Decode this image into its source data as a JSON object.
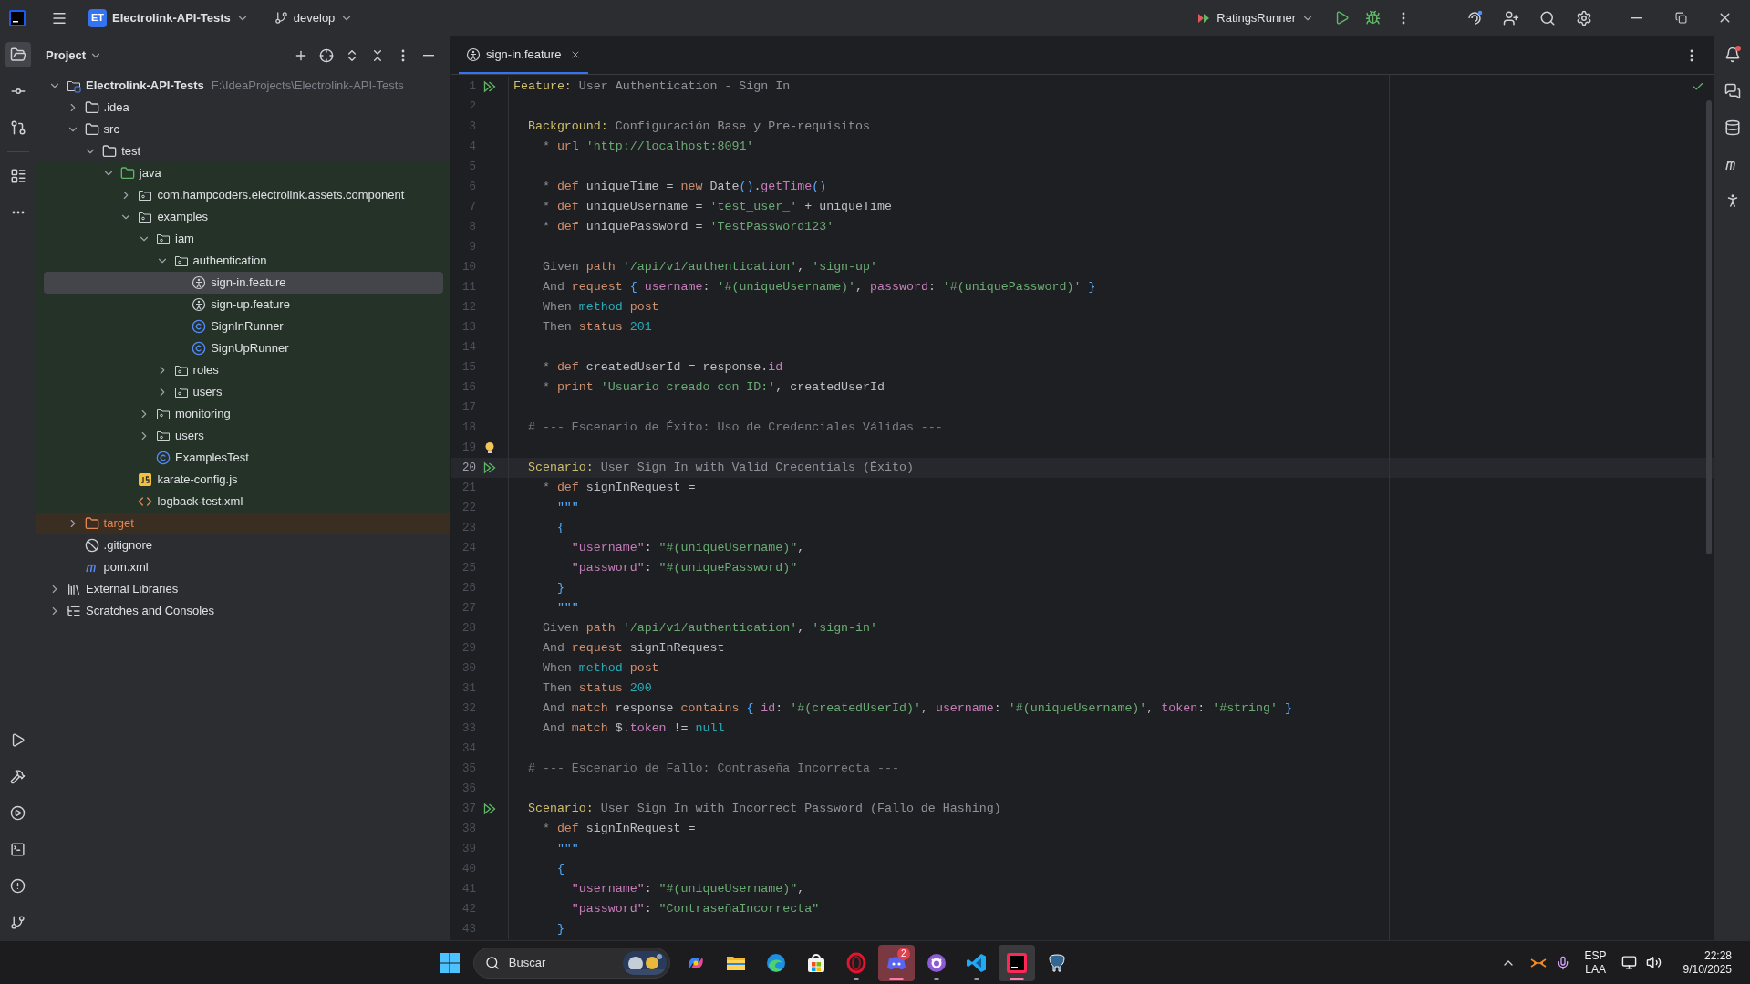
{
  "titlebar": {
    "project_badge": "ET",
    "project": "Electrolink-API-Tests",
    "branch": "develop",
    "run_config": "RatingsRunner"
  },
  "project_panel": {
    "title": "Project",
    "tree": [
      {
        "label": "Electrolink-API-Tests",
        "hint": "F:\\IdeaProjects\\Electrolink-API-Tests",
        "kind": "module",
        "expanded": true,
        "selected": false,
        "children": [
          {
            "label": ".idea",
            "kind": "folder",
            "expanded": false,
            "selected": false
          },
          {
            "label": "src",
            "kind": "folder",
            "expanded": true,
            "selected": false,
            "children": [
              {
                "label": "test",
                "kind": "folder",
                "expanded": true,
                "selected": false,
                "children": [
                  {
                    "label": "java",
                    "kind": "folder",
                    "expanded": true,
                    "selected": false,
                    "test_sources": true,
                    "children": [
                      {
                        "label": "com.hampcoders.electrolink.assets.component",
                        "kind": "package",
                        "expanded": false,
                        "selected": false
                      },
                      {
                        "label": "examples",
                        "kind": "package",
                        "expanded": true,
                        "selected": false,
                        "children": [
                          {
                            "label": "iam",
                            "kind": "package",
                            "expanded": true,
                            "selected": false,
                            "children": [
                              {
                                "label": "authentication",
                                "kind": "package",
                                "expanded": true,
                                "selected": false,
                                "children": [
                                  {
                                    "label": "sign-in.feature",
                                    "kind": "feature",
                                    "selected": true
                                  },
                                  {
                                    "label": "sign-up.feature",
                                    "kind": "feature",
                                    "selected": false
                                  },
                                  {
                                    "label": "SignInRunner",
                                    "kind": "class",
                                    "selected": false
                                  },
                                  {
                                    "label": "SignUpRunner",
                                    "kind": "class",
                                    "selected": false
                                  }
                                ]
                              },
                              {
                                "label": "roles",
                                "kind": "package",
                                "expanded": false,
                                "selected": false
                              },
                              {
                                "label": "users",
                                "kind": "package",
                                "expanded": false,
                                "selected": false
                              }
                            ]
                          },
                          {
                            "label": "monitoring",
                            "kind": "package",
                            "expanded": false,
                            "selected": false
                          },
                          {
                            "label": "users",
                            "kind": "package",
                            "expanded": false,
                            "selected": false
                          },
                          {
                            "label": "ExamplesTest",
                            "kind": "class",
                            "selected": false
                          }
                        ]
                      },
                      {
                        "label": "karate-config.js",
                        "kind": "js",
                        "selected": false
                      },
                      {
                        "label": "logback-test.xml",
                        "kind": "xml",
                        "selected": false
                      }
                    ]
                  }
                ]
              }
            ]
          },
          {
            "label": "target",
            "kind": "folder",
            "expanded": false,
            "selected": false,
            "excluded": true
          },
          {
            "label": ".gitignore",
            "kind": "ignore",
            "selected": false
          },
          {
            "label": "pom.xml",
            "kind": "maven",
            "selected": false
          }
        ]
      },
      {
        "label": "External Libraries",
        "kind": "libraries",
        "expanded": false,
        "selected": false
      },
      {
        "label": "Scratches and Consoles",
        "kind": "scratches",
        "expanded": false,
        "selected": false
      }
    ]
  },
  "tabs": [
    {
      "label": "sign-in.feature",
      "selected": true
    }
  ],
  "editor": {
    "lines": [
      {
        "n": "1",
        "run_marker": true,
        "current": false,
        "tokens": [
          {
            "kind": "kw",
            "text": "Feature:"
          },
          {
            "kind": "desc",
            "text": " User Authentication - Sign In"
          }
        ]
      },
      {
        "n": "2",
        "current": false
      },
      {
        "n": "3",
        "current": false,
        "tokens": [
          {
            "kind": "kw",
            "text": "  Background:"
          },
          {
            "kind": "desc",
            "text": " Configuración Base y Pre-requisitos"
          }
        ]
      },
      {
        "n": "4",
        "current": false,
        "tokens": [
          {
            "kind": "step",
            "text": "    *"
          },
          {
            "kind": "fn",
            "text": " url"
          },
          {
            "kind": "str",
            "text": " 'http://localhost:8091'"
          }
        ]
      },
      {
        "n": "5",
        "current": false
      },
      {
        "n": "6",
        "current": false,
        "tokens": [
          {
            "kind": "step",
            "text": "    *"
          },
          {
            "kind": "fn",
            "text": " def"
          },
          {
            "kind": "plain",
            "text": " uniqueTime = "
          },
          {
            "kind": "fn",
            "text": "new"
          },
          {
            "kind": "plain",
            "text": " Date"
          },
          {
            "kind": "brace",
            "text": "()"
          },
          {
            "kind": "plain",
            "text": "."
          },
          {
            "kind": "prop",
            "text": "getTime"
          },
          {
            "kind": "brace",
            "text": "()"
          }
        ]
      },
      {
        "n": "7",
        "current": false,
        "tokens": [
          {
            "kind": "step",
            "text": "    *"
          },
          {
            "kind": "fn",
            "text": " def"
          },
          {
            "kind": "plain",
            "text": " uniqueUsername = "
          },
          {
            "kind": "str",
            "text": "'test_user_'"
          },
          {
            "kind": "plain",
            "text": " + uniqueTime"
          }
        ]
      },
      {
        "n": "8",
        "current": false,
        "tokens": [
          {
            "kind": "step",
            "text": "    *"
          },
          {
            "kind": "fn",
            "text": " def"
          },
          {
            "kind": "plain",
            "text": " uniquePassword = "
          },
          {
            "kind": "str",
            "text": "'TestPassword123'"
          }
        ]
      },
      {
        "n": "9",
        "current": false
      },
      {
        "n": "10",
        "current": false,
        "tokens": [
          {
            "kind": "step",
            "text": "    Given"
          },
          {
            "kind": "fn",
            "text": " path"
          },
          {
            "kind": "str",
            "text": " '/api/v1/authentication'"
          },
          {
            "kind": "plain",
            "text": ", "
          },
          {
            "kind": "str",
            "text": "'sign-up'"
          }
        ]
      },
      {
        "n": "11",
        "current": false,
        "tokens": [
          {
            "kind": "step",
            "text": "    And"
          },
          {
            "kind": "fn",
            "text": " request"
          },
          {
            "kind": "brace",
            "text": " {"
          },
          {
            "kind": "prop",
            "text": " username"
          },
          {
            "kind": "plain",
            "text": ": "
          },
          {
            "kind": "str",
            "text": "'#(uniqueUsername)'"
          },
          {
            "kind": "plain",
            "text": ", "
          },
          {
            "kind": "prop",
            "text": "password"
          },
          {
            "kind": "plain",
            "text": ": "
          },
          {
            "kind": "str",
            "text": "'#(uniquePassword)'"
          },
          {
            "kind": "brace",
            "text": " }"
          }
        ]
      },
      {
        "n": "12",
        "current": false,
        "tokens": [
          {
            "kind": "step",
            "text": "    When"
          },
          {
            "kind": "num",
            "text": " method"
          },
          {
            "kind": "fn",
            "text": " post"
          }
        ]
      },
      {
        "n": "13",
        "current": false,
        "tokens": [
          {
            "kind": "step",
            "text": "    Then"
          },
          {
            "kind": "fn",
            "text": " status"
          },
          {
            "kind": "num",
            "text": " 201"
          }
        ]
      },
      {
        "n": "14",
        "current": false
      },
      {
        "n": "15",
        "current": false,
        "tokens": [
          {
            "kind": "step",
            "text": "    *"
          },
          {
            "kind": "fn",
            "text": " def"
          },
          {
            "kind": "plain",
            "text": " createdUserId = response."
          },
          {
            "kind": "prop",
            "text": "id"
          }
        ]
      },
      {
        "n": "16",
        "current": false,
        "tokens": [
          {
            "kind": "step",
            "text": "    *"
          },
          {
            "kind": "fn",
            "text": " print"
          },
          {
            "kind": "str",
            "text": " 'Usuario creado con ID:'"
          },
          {
            "kind": "plain",
            "text": ", createdUserId"
          }
        ]
      },
      {
        "n": "17",
        "current": false
      },
      {
        "n": "18",
        "current": false,
        "tokens": [
          {
            "kind": "comment",
            "text": "  # --- Escenario de Éxito: Uso de Credenciales Válidas ---"
          }
        ]
      },
      {
        "n": "19",
        "bulb": true,
        "current": false
      },
      {
        "n": "20",
        "run_marker": true,
        "current": true,
        "tokens": [
          {
            "kind": "kw",
            "text": "  Scenario:"
          },
          {
            "kind": "desc",
            "text": " User Sign In with Valid Credentials (Éxito)"
          }
        ]
      },
      {
        "n": "21",
        "current": false,
        "tokens": [
          {
            "kind": "step",
            "text": "    *"
          },
          {
            "kind": "fn",
            "text": " def"
          },
          {
            "kind": "plain",
            "text": " signInRequest ="
          }
        ]
      },
      {
        "n": "22",
        "current": false,
        "tokens": [
          {
            "kind": "brace",
            "text": "      \"\"\""
          }
        ]
      },
      {
        "n": "23",
        "current": false,
        "tokens": [
          {
            "kind": "brace",
            "text": "      {"
          }
        ]
      },
      {
        "n": "24",
        "current": false,
        "tokens": [
          {
            "kind": "prop",
            "text": "        \"username\""
          },
          {
            "kind": "plain",
            "text": ": "
          },
          {
            "kind": "str",
            "text": "\"#(uniqueUsername)\""
          },
          {
            "kind": "plain",
            "text": ","
          }
        ]
      },
      {
        "n": "25",
        "current": false,
        "tokens": [
          {
            "kind": "prop",
            "text": "        \"password\""
          },
          {
            "kind": "plain",
            "text": ": "
          },
          {
            "kind": "str",
            "text": "\"#(uniquePassword)\""
          }
        ]
      },
      {
        "n": "26",
        "current": false,
        "tokens": [
          {
            "kind": "brace",
            "text": "      }"
          }
        ]
      },
      {
        "n": "27",
        "current": false,
        "tokens": [
          {
            "kind": "brace",
            "text": "      \"\"\""
          }
        ]
      },
      {
        "n": "28",
        "current": false,
        "tokens": [
          {
            "kind": "step",
            "text": "    Given"
          },
          {
            "kind": "fn",
            "text": " path"
          },
          {
            "kind": "str",
            "text": " '/api/v1/authentication'"
          },
          {
            "kind": "plain",
            "text": ", "
          },
          {
            "kind": "str",
            "text": "'sign-in'"
          }
        ]
      },
      {
        "n": "29",
        "current": false,
        "tokens": [
          {
            "kind": "step",
            "text": "    And"
          },
          {
            "kind": "fn",
            "text": " request"
          },
          {
            "kind": "plain",
            "text": " signInRequest"
          }
        ]
      },
      {
        "n": "30",
        "current": false,
        "tokens": [
          {
            "kind": "step",
            "text": "    When"
          },
          {
            "kind": "num",
            "text": " method"
          },
          {
            "kind": "fn",
            "text": " post"
          }
        ]
      },
      {
        "n": "31",
        "current": false,
        "tokens": [
          {
            "kind": "step",
            "text": "    Then"
          },
          {
            "kind": "fn",
            "text": " status"
          },
          {
            "kind": "num",
            "text": " 200"
          }
        ]
      },
      {
        "n": "32",
        "current": false,
        "tokens": [
          {
            "kind": "step",
            "text": "    And"
          },
          {
            "kind": "fn",
            "text": " match"
          },
          {
            "kind": "plain",
            "text": " response"
          },
          {
            "kind": "fn",
            "text": " contains"
          },
          {
            "kind": "brace",
            "text": " {"
          },
          {
            "kind": "prop",
            "text": " id"
          },
          {
            "kind": "plain",
            "text": ": "
          },
          {
            "kind": "str",
            "text": "'#(createdUserId)'"
          },
          {
            "kind": "plain",
            "text": ", "
          },
          {
            "kind": "prop",
            "text": "username"
          },
          {
            "kind": "plain",
            "text": ": "
          },
          {
            "kind": "str",
            "text": "'#(uniqueUsername)'"
          },
          {
            "kind": "plain",
            "text": ", "
          },
          {
            "kind": "prop",
            "text": "token"
          },
          {
            "kind": "plain",
            "text": ": "
          },
          {
            "kind": "str",
            "text": "'#string'"
          },
          {
            "kind": "brace",
            "text": " }"
          }
        ]
      },
      {
        "n": "33",
        "current": false,
        "tokens": [
          {
            "kind": "step",
            "text": "    And"
          },
          {
            "kind": "fn",
            "text": " match"
          },
          {
            "kind": "plain",
            "text": " $."
          },
          {
            "kind": "prop",
            "text": "token"
          },
          {
            "kind": "plain",
            "text": " != "
          },
          {
            "kind": "num",
            "text": "null"
          }
        ]
      },
      {
        "n": "34",
        "current": false
      },
      {
        "n": "35",
        "current": false,
        "tokens": [
          {
            "kind": "comment",
            "text": "  # --- Escenario de Fallo: Contraseña Incorrecta ---"
          }
        ]
      },
      {
        "n": "36",
        "current": false
      },
      {
        "n": "37",
        "run_marker": true,
        "current": false,
        "tokens": [
          {
            "kind": "kw",
            "text": "  Scenario:"
          },
          {
            "kind": "desc",
            "text": " User Sign In with Incorrect Password (Fallo de Hashing)"
          }
        ]
      },
      {
        "n": "38",
        "current": false,
        "tokens": [
          {
            "kind": "step",
            "text": "    *"
          },
          {
            "kind": "fn",
            "text": " def"
          },
          {
            "kind": "plain",
            "text": " signInRequest ="
          }
        ]
      },
      {
        "n": "39",
        "current": false,
        "tokens": [
          {
            "kind": "brace",
            "text": "      \"\"\""
          }
        ]
      },
      {
        "n": "40",
        "current": false,
        "tokens": [
          {
            "kind": "brace",
            "text": "      {"
          }
        ]
      },
      {
        "n": "41",
        "current": false,
        "tokens": [
          {
            "kind": "prop",
            "text": "        \"username\""
          },
          {
            "kind": "plain",
            "text": ": "
          },
          {
            "kind": "str",
            "text": "\"#(uniqueUsername)\""
          },
          {
            "kind": "plain",
            "text": ","
          }
        ]
      },
      {
        "n": "42",
        "current": false,
        "tokens": [
          {
            "kind": "prop",
            "text": "        \"password\""
          },
          {
            "kind": "plain",
            "text": ": "
          },
          {
            "kind": "str",
            "text": "\"ContraseñaIncorrecta\""
          }
        ]
      },
      {
        "n": "43",
        "current": false,
        "tokens": [
          {
            "kind": "brace",
            "text": "      }"
          }
        ]
      }
    ]
  },
  "taskbar": {
    "search": {
      "placeholder": "Buscar"
    },
    "apps": [
      {
        "kind": "copilot",
        "running": false,
        "focused": false
      },
      {
        "kind": "explorer",
        "running": false,
        "focused": false
      },
      {
        "kind": "edge",
        "running": false,
        "focused": false
      },
      {
        "kind": "store",
        "running": false,
        "focused": false
      },
      {
        "kind": "opera",
        "running": true,
        "focused": false
      },
      {
        "kind": "discord",
        "running": true,
        "focused": false,
        "flashing": true,
        "badge": "2"
      },
      {
        "kind": "github",
        "running": true,
        "focused": false
      },
      {
        "kind": "vscode",
        "running": true,
        "focused": false
      },
      {
        "kind": "intellij",
        "running": true,
        "focused": true
      },
      {
        "kind": "pgadmin",
        "running": false,
        "focused": false
      }
    ],
    "tray": {
      "language": "ESP",
      "region": "LAA",
      "time": "22:28",
      "date": "9/10/2025"
    }
  }
}
